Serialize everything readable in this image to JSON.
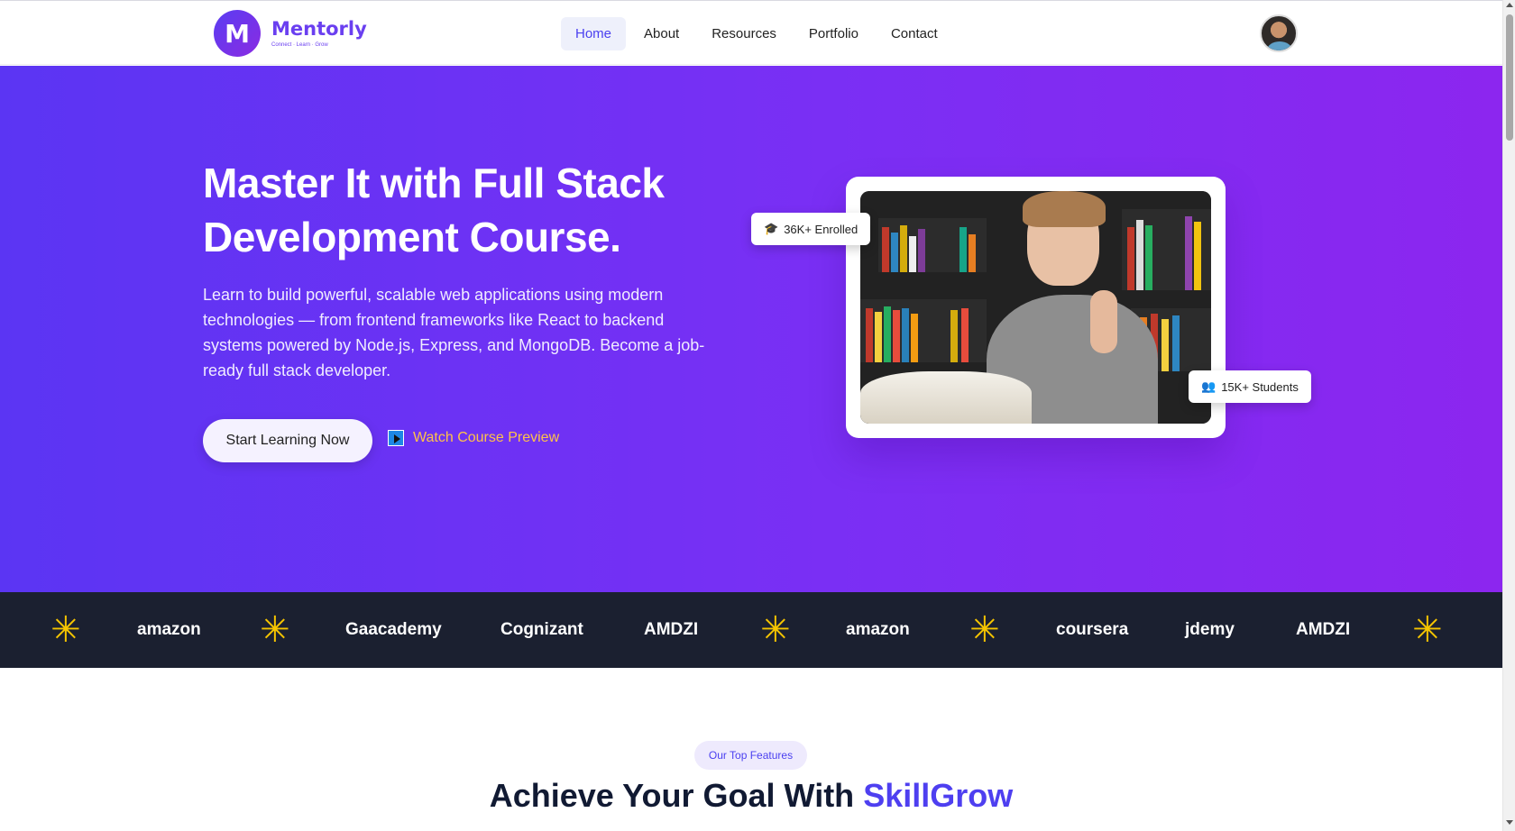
{
  "header": {
    "logo_letter": "M",
    "logo_name": "Mentorly",
    "logo_tagline": "Connect · Learn · Grow",
    "nav": [
      {
        "label": "Home",
        "active": true
      },
      {
        "label": "About"
      },
      {
        "label": "Resources"
      },
      {
        "label": "Portfolio"
      },
      {
        "label": "Contact"
      }
    ]
  },
  "hero": {
    "title": "Master It with Full Stack Development Course.",
    "description": "Learn to build powerful, scalable web applications using modern technologies — from frontend frameworks like React to backend systems powered by Node.js, Express, and MongoDB. Become a job-ready full stack developer.",
    "primary_button": "Start Learning Now",
    "preview_link": "Watch Course Preview",
    "enrolled_badge": "36K+ Enrolled",
    "students_badge": "15K+ Students",
    "colors": {
      "gradient_start": "#5b35f3",
      "gradient_end": "#8c26ef",
      "preview_link": "#ffc24a"
    }
  },
  "partners": {
    "items": [
      "amazon",
      "Gaacademy",
      "Cognizant",
      "AMDZI",
      "amazon",
      "coursera",
      "jdemy",
      "AMDZI"
    ],
    "separator_icon": "asterisk-icon",
    "separator_char": "✳",
    "colors": {
      "background": "#1b2030",
      "star": "#f5c400"
    }
  },
  "features": {
    "pill": "Our Top Features",
    "title_main": "Achieve Your Goal With",
    "title_accent": "SkillGrow"
  }
}
